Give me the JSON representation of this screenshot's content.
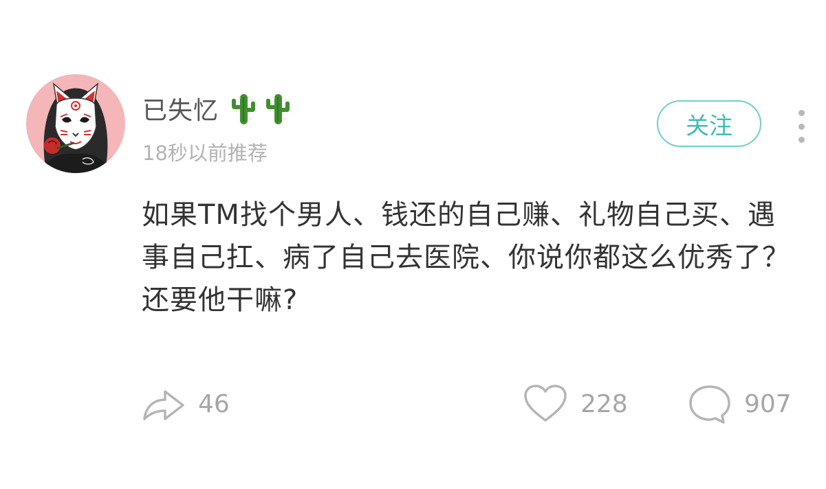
{
  "user": {
    "name": "已失忆",
    "badges": [
      "cactus-emoji",
      "cactus-emoji"
    ],
    "timestamp": "18秒以前推荐"
  },
  "follow": {
    "label": "关注",
    "accent": "#3fbcb4"
  },
  "post": {
    "text": "如果TM找个男人、钱还的自己赚、礼物自己买、遇事自己扛、病了自己去医院、你说你都这么优秀了？还要他干嘛?"
  },
  "actions": {
    "share": {
      "icon": "share-arrow-icon",
      "count": "46"
    },
    "like": {
      "icon": "heart-icon",
      "count": "228"
    },
    "comment": {
      "icon": "comment-bubble-icon",
      "count": "907"
    }
  },
  "colors": {
    "avatar_bg": "#f4b6b8",
    "text": "#333333",
    "muted": "#a6a6a6"
  }
}
